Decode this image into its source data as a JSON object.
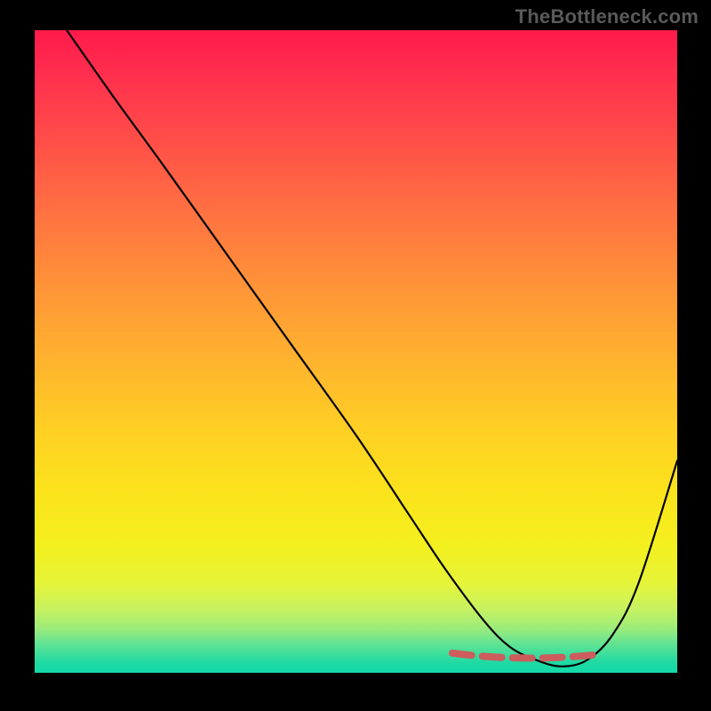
{
  "attribution": "TheBottleneck.com",
  "colors": {
    "background": "#000000",
    "curve": "#000000",
    "valley_dash": "#cd5c5c",
    "gradient_top": "#ff1a4b",
    "gradient_bottom": "#13d9a9"
  },
  "chart_data": {
    "type": "line",
    "title": "",
    "xlabel": "",
    "ylabel": "",
    "xlim": [
      0,
      100
    ],
    "ylim": [
      0,
      100
    ],
    "series": [
      {
        "name": "bottleneck-curve",
        "x": [
          5,
          12,
          20,
          30,
          40,
          50,
          58,
          64,
          70,
          74,
          78,
          82,
          86,
          90,
          94,
          100
        ],
        "values": [
          100,
          90,
          79,
          65,
          51,
          37,
          25,
          16,
          8,
          4,
          2,
          1,
          2,
          6,
          14,
          33
        ]
      }
    ],
    "annotations": [
      {
        "name": "optimal-valley-dash",
        "x_range": [
          65,
          87
        ],
        "y": 2.5,
        "style": "dashed"
      }
    ]
  }
}
